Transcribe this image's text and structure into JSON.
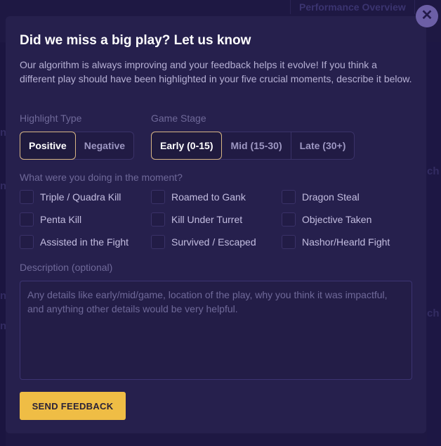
{
  "background": {
    "tab_label": "Performance Overview",
    "fragments": [
      "n",
      "n",
      "ch",
      "n",
      "n",
      "ch"
    ]
  },
  "modal": {
    "close_icon": "✕",
    "title": "Did we miss a big play? Let us know",
    "intro": "Our algorithm is always improving and your feedback helps it evolve! If you think a different play should have been highlighted in your five crucial moments, describe it below.",
    "highlight_type": {
      "label": "Highlight Type",
      "options": [
        "Positive",
        "Negative"
      ],
      "selected": "Positive"
    },
    "game_stage": {
      "label": "Game Stage",
      "options": [
        "Early (0-15)",
        "Mid (15-30)",
        "Late (30+)"
      ],
      "selected": "Early (0-15)"
    },
    "activity": {
      "label": "What were you doing in the moment?",
      "options": [
        {
          "label": "Triple / Quadra Kill",
          "checked": false
        },
        {
          "label": "Roamed to Gank",
          "checked": false
        },
        {
          "label": "Dragon Steal",
          "checked": false
        },
        {
          "label": "Penta Kill",
          "checked": false
        },
        {
          "label": "Kill Under Turret",
          "checked": false
        },
        {
          "label": "Objective Taken",
          "checked": false
        },
        {
          "label": "Assisted in the Fight",
          "checked": false
        },
        {
          "label": "Survived / Escaped",
          "checked": false
        },
        {
          "label": "Nashor/Hearld Fight",
          "checked": false
        }
      ]
    },
    "description": {
      "label": "Description (optional)",
      "value": "",
      "placeholder": "Any details like early/mid/game, location of the play, why you think it was impactful, and anything other details would be very helpful."
    },
    "send_label": "SEND FEEDBACK"
  },
  "colors": {
    "accent": "#efbd45",
    "selected_border": "#d8b685",
    "modal_bg": "#26204d",
    "page_bg": "#1c1640"
  }
}
